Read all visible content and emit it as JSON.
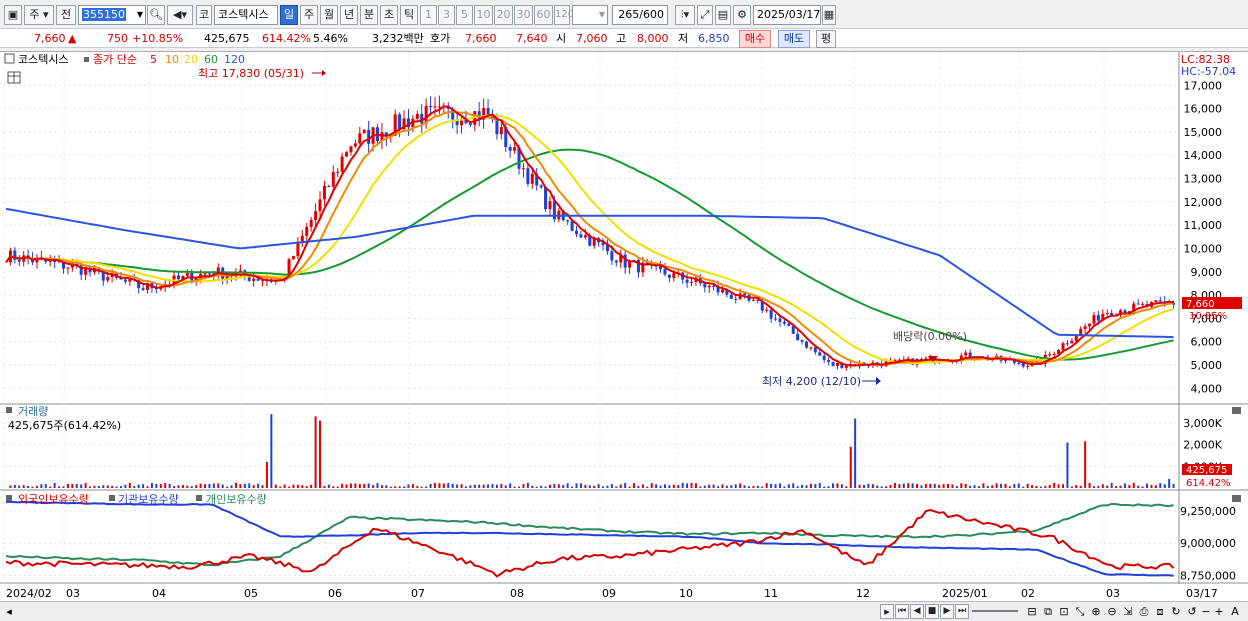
{
  "toolbar": {
    "market_btn": "주",
    "prev_btn": "전",
    "stock_code": "355150",
    "market_label": "코",
    "stock_name": "코스텍시스",
    "periods": [
      "일",
      "주",
      "월",
      "년",
      "분",
      "초",
      "틱"
    ],
    "active_period": "일",
    "intervals": [
      "1",
      "3",
      "5",
      "10",
      "20",
      "30",
      "60",
      "120"
    ],
    "count_display": "265",
    "count_max": "/600",
    "date": "2025/03/17"
  },
  "quote": {
    "price": "7,660",
    "change_arrow": "▲",
    "change": "750",
    "change_pct": "+10.85%",
    "volume": "425,675",
    "volume_pct": "614.42%",
    "turnover_pct": "5.46%",
    "amount": "3,232백만",
    "ask_label": "호가",
    "ask": "7,660",
    "bid": "7,640",
    "open_label": "시",
    "open": "7,060",
    "high_label": "고",
    "high": "8,000",
    "low_label": "저",
    "low": "6,850",
    "buy_btn": "매수",
    "sell_btn": "매도",
    "eval_btn": "평"
  },
  "price_panel": {
    "stock_label": "코스텍시스",
    "ma_title": "종가 단순",
    "ma_periods": [
      {
        "label": "5",
        "color": "#e00000"
      },
      {
        "label": "10",
        "color": "#f08a00"
      },
      {
        "label": "20",
        "color": "#f0e000"
      },
      {
        "label": "60",
        "color": "#149a30"
      },
      {
        "label": "120",
        "color": "#2a55e0"
      }
    ],
    "lc_label": "LC:82.38",
    "hc_label": "HC:-57.04",
    "high_annotation": "최고 17,830 (05/31)",
    "low_annotation": "최저 4,200 (12/10)",
    "dividend_annotation": "배당락(0.00%)",
    "last_price_tag": "7,660",
    "last_pct_tag": "10.85%"
  },
  "volume_panel": {
    "title": "거래량",
    "value_label": "425,675주(614.42%)",
    "axis": [
      "3,000K",
      "2,000K",
      "1,000K"
    ],
    "last_tag": "425,675",
    "last_pct": "614.42%"
  },
  "holdings_panel": {
    "legends": [
      {
        "label": "외국인보유수량",
        "color": "#d40000"
      },
      {
        "label": "기관보유수량",
        "color": "#1f3fd8"
      },
      {
        "label": "개인보유수량",
        "color": "#2a8a5a"
      }
    ],
    "axis": [
      "9,250,000",
      "9,000,000",
      "8,750,000"
    ]
  },
  "x_axis": [
    "2024/02",
    "03",
    "04",
    "05",
    "06",
    "07",
    "08",
    "09",
    "10",
    "11",
    "12",
    "2025/01",
    "02",
    "03",
    "03/17"
  ],
  "chart_data": {
    "type": "line",
    "title": "코스텍시스",
    "x": [
      "2024/02",
      "03",
      "04",
      "05",
      "06",
      "07",
      "08",
      "09",
      "10",
      "11",
      "12",
      "2025/01",
      "02",
      "03",
      "03/17"
    ],
    "ylim": [
      3500,
      18000
    ],
    "y_ticks": [
      4000,
      5000,
      6000,
      7000,
      8000,
      9000,
      10000,
      11000,
      12000,
      13000,
      14000,
      15000,
      16000,
      17000
    ],
    "series": [
      {
        "name": "종가",
        "color": "#d40000",
        "values": [
          9700,
          9200,
          8300,
          9000,
          8600,
          14500,
          15700,
          15800,
          11400,
          9400,
          8600,
          7500,
          5000,
          5100,
          5400,
          5000,
          7300,
          7660
        ]
      },
      {
        "name": "120",
        "color": "#2a55e0",
        "values": [
          11700,
          10800,
          10000,
          10500,
          11400,
          11400,
          11400,
          11300,
          9700,
          6300,
          6200
        ]
      }
    ],
    "volume": {
      "ylim": [
        0,
        3500
      ],
      "y_ticks": [
        1000,
        2000,
        3000
      ],
      "unit": "K"
    },
    "holdings_ylim": [
      8700000,
      9350000
    ],
    "holdings_ticks": [
      8750000,
      9000000,
      9250000
    ]
  },
  "bottombar": {
    "buttons": [
      "▸",
      "⏮",
      "◀",
      "■",
      "▶",
      "⏭"
    ],
    "zoom_minus": "−",
    "zoom_plus": "+",
    "font_a": "A"
  }
}
